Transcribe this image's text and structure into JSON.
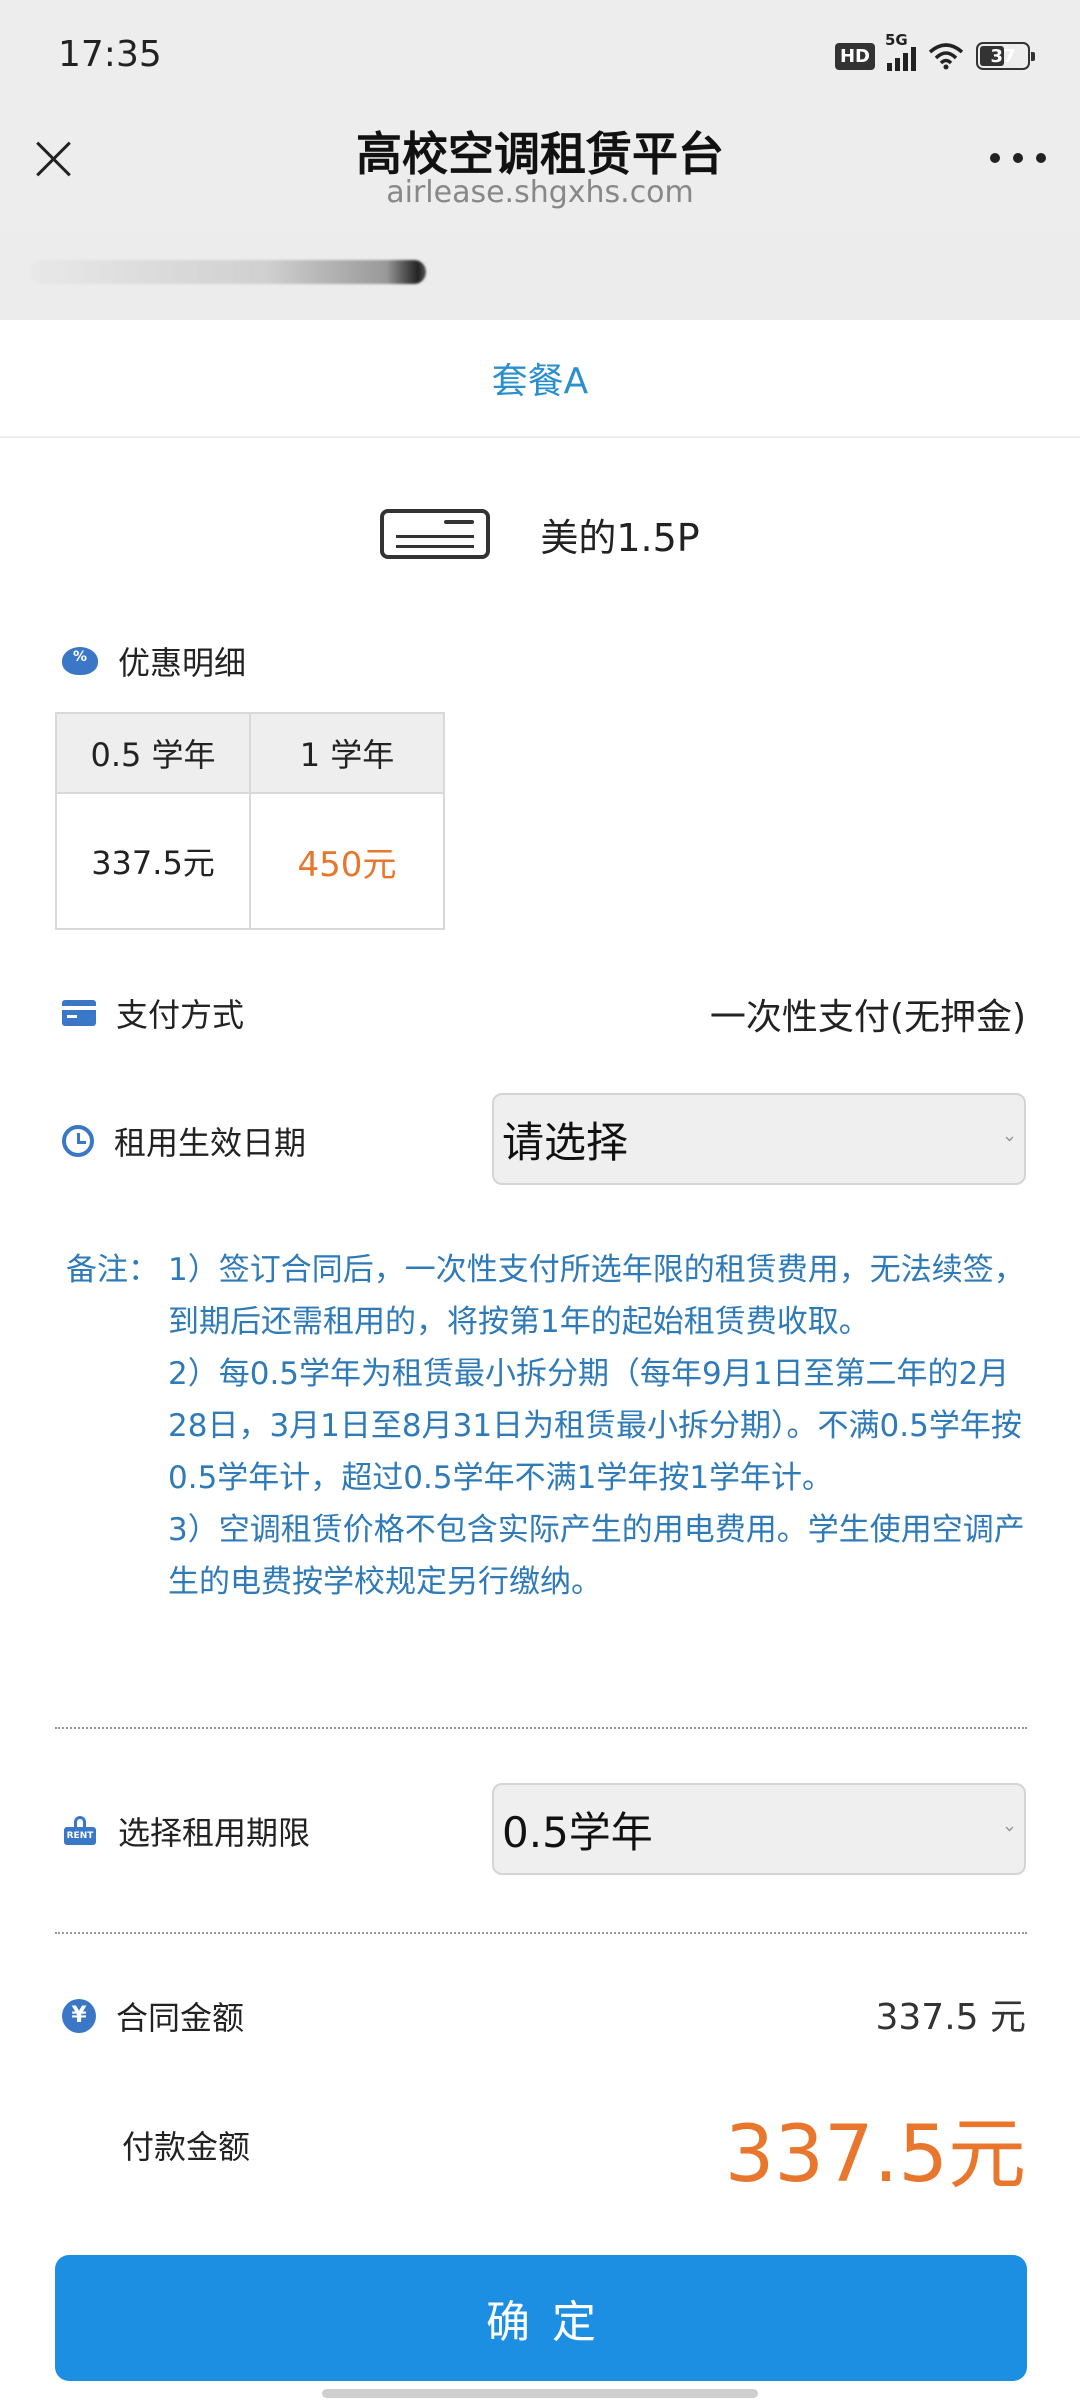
{
  "status_bar": {
    "time": "17:35",
    "hd_badge": "HD",
    "network": "5G",
    "battery": "37"
  },
  "nav": {
    "title": "高校空调租赁平台",
    "url": "airlease.shgxhs.com"
  },
  "package_tab": "套餐A",
  "product": {
    "name": "美的1.5P"
  },
  "discount": {
    "label": "优惠明细",
    "columns": [
      "0.5 学年",
      "1 学年"
    ],
    "prices": [
      "337.5元",
      "450元"
    ]
  },
  "payment": {
    "label": "支付方式",
    "value": "一次性支付(无押金)"
  },
  "effective_date": {
    "label": "租用生效日期",
    "value": "请选择"
  },
  "notes": {
    "head": "备注：",
    "items": [
      "1）签订合同后，一次性支付所选年限的租赁费用，无法续签，到期后还需租用的，将按第1年的起始租赁费收取。",
      "2）每0.5学年为租赁最小拆分期（每年9月1日至第二年的2月28日，3月1日至8月31日为租赁最小拆分期）。不满0.5学年按0.5学年计，超过0.5学年不满1学年按1学年计。",
      "3）空调租赁价格不包含实际产生的用电费用。学生使用空调产生的电费按学校规定另行缴纳。"
    ]
  },
  "term": {
    "label": "选择租用期限",
    "value": "0.5学年",
    "icon_text": "RENT"
  },
  "contract": {
    "label": "合同金额",
    "value": "337.5 元"
  },
  "payment_amount": {
    "label": "付款金额",
    "value": "337.5元"
  },
  "confirm_label": "确定",
  "colors": {
    "accent_blue": "#1d8fe3",
    "notes_blue": "#2f7ab8",
    "price_orange": "#e8762d",
    "icon_blue": "#3a77c6"
  }
}
